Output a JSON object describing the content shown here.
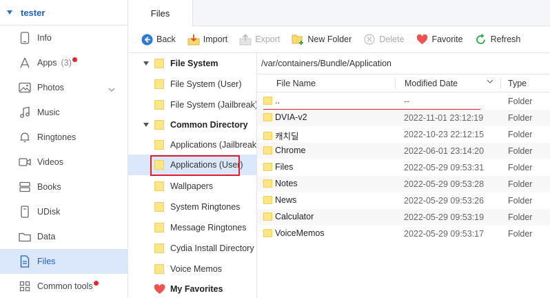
{
  "nav": {
    "device_name": "tester",
    "items": [
      {
        "label": "Info",
        "icon": "phone-icon"
      },
      {
        "label": "Apps",
        "icon": "apps-icon",
        "count": "(3)",
        "badge": true
      },
      {
        "label": "Photos",
        "icon": "photos-icon",
        "expandable": true
      },
      {
        "label": "Music",
        "icon": "music-note-icon"
      },
      {
        "label": "Ringtones",
        "icon": "bell-icon"
      },
      {
        "label": "Videos",
        "icon": "video-camera-icon"
      },
      {
        "label": "Books",
        "icon": "books-icon"
      },
      {
        "label": "UDisk",
        "icon": "udisk-icon"
      },
      {
        "label": "Data",
        "icon": "folder-icon"
      },
      {
        "label": "Files",
        "icon": "file-icon",
        "active": true
      },
      {
        "label": "Common tools",
        "icon": "grid-icon",
        "badge": true
      }
    ]
  },
  "tabs": [
    {
      "label": "Files"
    }
  ],
  "toolbar": {
    "back": "Back",
    "import": "Import",
    "export": "Export",
    "new_folder": "New Folder",
    "delete": "Delete",
    "favorite": "Favorite",
    "refresh": "Refresh"
  },
  "tree": {
    "file_system": {
      "label": "File System",
      "children": [
        "File System (User)",
        "File System (Jailbreak)"
      ]
    },
    "common_directory": {
      "label": "Common Directory",
      "children": [
        "Applications (Jailbreak)",
        "Applications (User)",
        "Wallpapers",
        "System Ringtones",
        "Message Ringtones",
        "Cydia Install Directory",
        "Voice Memos"
      ]
    },
    "my_favorites": {
      "label": "My Favorites"
    }
  },
  "path": "/var/containers/Bundle/Application",
  "columns": {
    "name": "File Name",
    "modified": "Modified Date",
    "type": "Type"
  },
  "files": [
    {
      "name": "..",
      "date": "--",
      "type": "Folder"
    },
    {
      "name": "DVIA-v2",
      "date": "2022-11-01 23:12:19",
      "type": "Folder"
    },
    {
      "name": "캐치딜",
      "date": "2022-10-23 22:12:15",
      "type": "Folder"
    },
    {
      "name": "Chrome",
      "date": "2022-06-01 23:14:20",
      "type": "Folder"
    },
    {
      "name": "Files",
      "date": "2022-05-29 09:53:31",
      "type": "Folder"
    },
    {
      "name": "Notes",
      "date": "2022-05-29 09:53:28",
      "type": "Folder"
    },
    {
      "name": "News",
      "date": "2022-05-29 09:53:26",
      "type": "Folder"
    },
    {
      "name": "Calculator",
      "date": "2022-05-29 09:53:19",
      "type": "Folder"
    },
    {
      "name": "VoiceMemos",
      "date": "2022-05-29 09:53:17",
      "type": "Folder"
    }
  ],
  "colors": {
    "accent": "#1f5fbf",
    "selected_bg": "#dbe7fa",
    "highlight": "#e01e2b",
    "badge": "#e8262b"
  }
}
